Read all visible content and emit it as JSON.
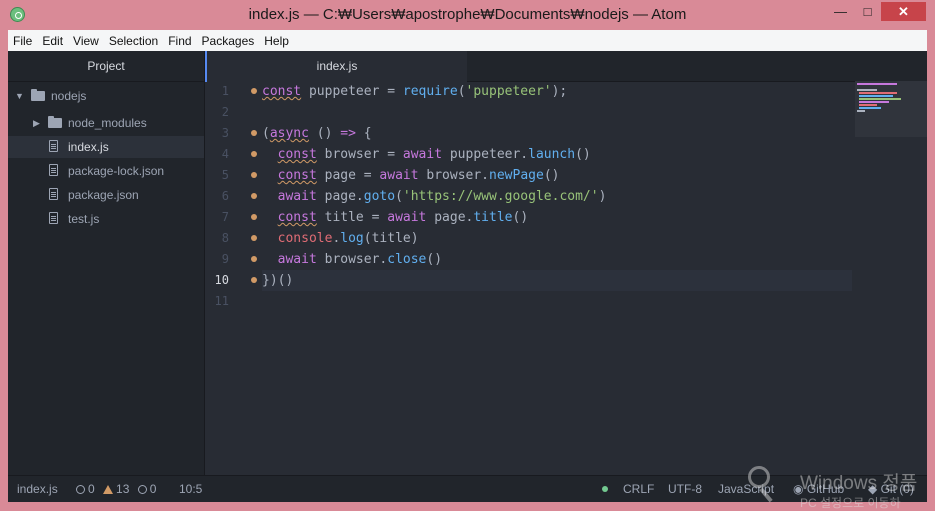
{
  "window": {
    "title": "index.js — C:₩Users₩apostrophe₩Documents₩nodejs — Atom",
    "minimize": "—",
    "maximize": "□",
    "close": "✕"
  },
  "menu": [
    "File",
    "Edit",
    "View",
    "Selection",
    "Find",
    "Packages",
    "Help"
  ],
  "tree": {
    "header": "Project",
    "root": "nodejs",
    "items": [
      {
        "label": "node_modules",
        "type": "folder"
      },
      {
        "label": "index.js",
        "type": "file",
        "selected": true
      },
      {
        "label": "package-lock.json",
        "type": "file"
      },
      {
        "label": "package.json",
        "type": "file"
      },
      {
        "label": "test.js",
        "type": "file"
      }
    ]
  },
  "tab": {
    "label": "index.js"
  },
  "editor": {
    "line_numbers": [
      "1",
      "2",
      "3",
      "4",
      "5",
      "6",
      "7",
      "8",
      "9",
      "10",
      "11"
    ],
    "current_line": "10",
    "code_lines": [
      "const puppeteer = require('puppeteer');",
      "",
      "(async () => {",
      "  const browser = await puppeteer.launch()",
      "  const page = await browser.newPage()",
      "  await page.goto('https://www.google.com/')",
      "  const title = await page.title()",
      "  console.log(title)",
      "  await browser.close()",
      "})()",
      ""
    ]
  },
  "status": {
    "file": "index.js",
    "errors": "0",
    "warnings": "13",
    "infos": "0",
    "cursor": "10:5",
    "line_ending": "CRLF",
    "encoding": "UTF-8",
    "grammar": "JavaScript",
    "github": "GitHub",
    "git": "Git (0)"
  },
  "watermark": {
    "line1": "Windows 정품",
    "line2": "PC 설정으로 이동하"
  },
  "colors": {
    "keyword": "#c678dd",
    "function": "#61afef",
    "string": "#98c379",
    "warning": "#d19a66",
    "accent": "#568af2"
  }
}
